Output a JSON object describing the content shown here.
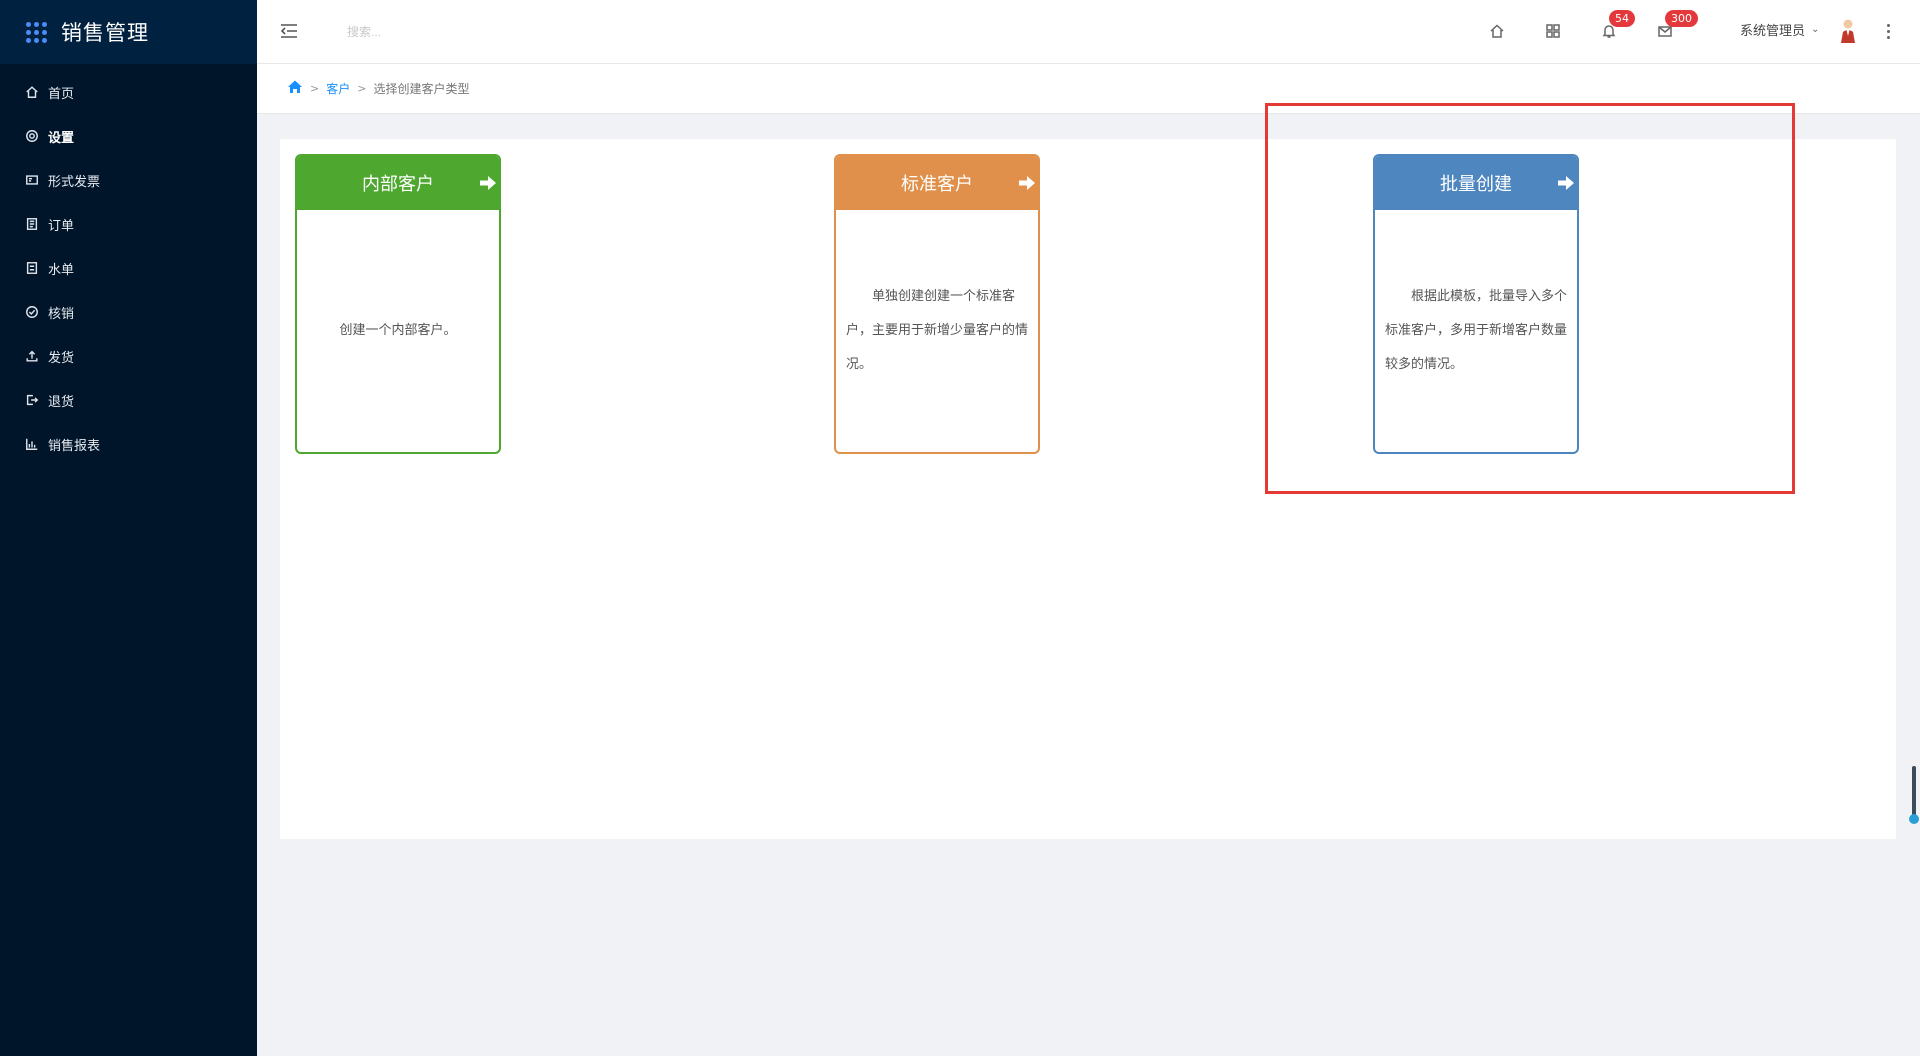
{
  "sidebar": {
    "brand_title": "销售管理",
    "items": [
      {
        "label": "首页",
        "icon": "home-icon",
        "active": false
      },
      {
        "label": "设置",
        "icon": "gear-icon",
        "active": true
      },
      {
        "label": "形式发票",
        "icon": "invoice-icon",
        "active": false
      },
      {
        "label": "订单",
        "icon": "order-icon",
        "active": false
      },
      {
        "label": "水单",
        "icon": "receipt-icon",
        "active": false
      },
      {
        "label": "核销",
        "icon": "check-circle-icon",
        "active": false
      },
      {
        "label": "发货",
        "icon": "upload-icon",
        "active": false
      },
      {
        "label": "退货",
        "icon": "return-icon",
        "active": false
      },
      {
        "label": "销售报表",
        "icon": "bar-chart-icon",
        "active": false
      }
    ]
  },
  "header": {
    "search_placeholder": "搜索...",
    "notifications_count": "54",
    "messages_count": "300",
    "user_name": "系统管理员"
  },
  "breadcrumb": {
    "link": "客户",
    "current": "选择创建客户类型",
    "separator": ">"
  },
  "cards": [
    {
      "title": "内部客户",
      "description": "创建一个内部客户。",
      "color": "#4ea72e"
    },
    {
      "title": "标准客户",
      "description": "单独创建创建一个标准客户，主要用于新增少量客户的情况。",
      "color": "#e0904a"
    },
    {
      "title": "批量创建",
      "description": "根据此模板，批量导入多个标准客户，多用于新增客户数量较多的情况。",
      "color": "#4e86c0"
    }
  ],
  "colors": {
    "sidebar_bg": "#001529",
    "highlight": "#e53935",
    "badge": "#e4393c",
    "link": "#1890ff"
  }
}
